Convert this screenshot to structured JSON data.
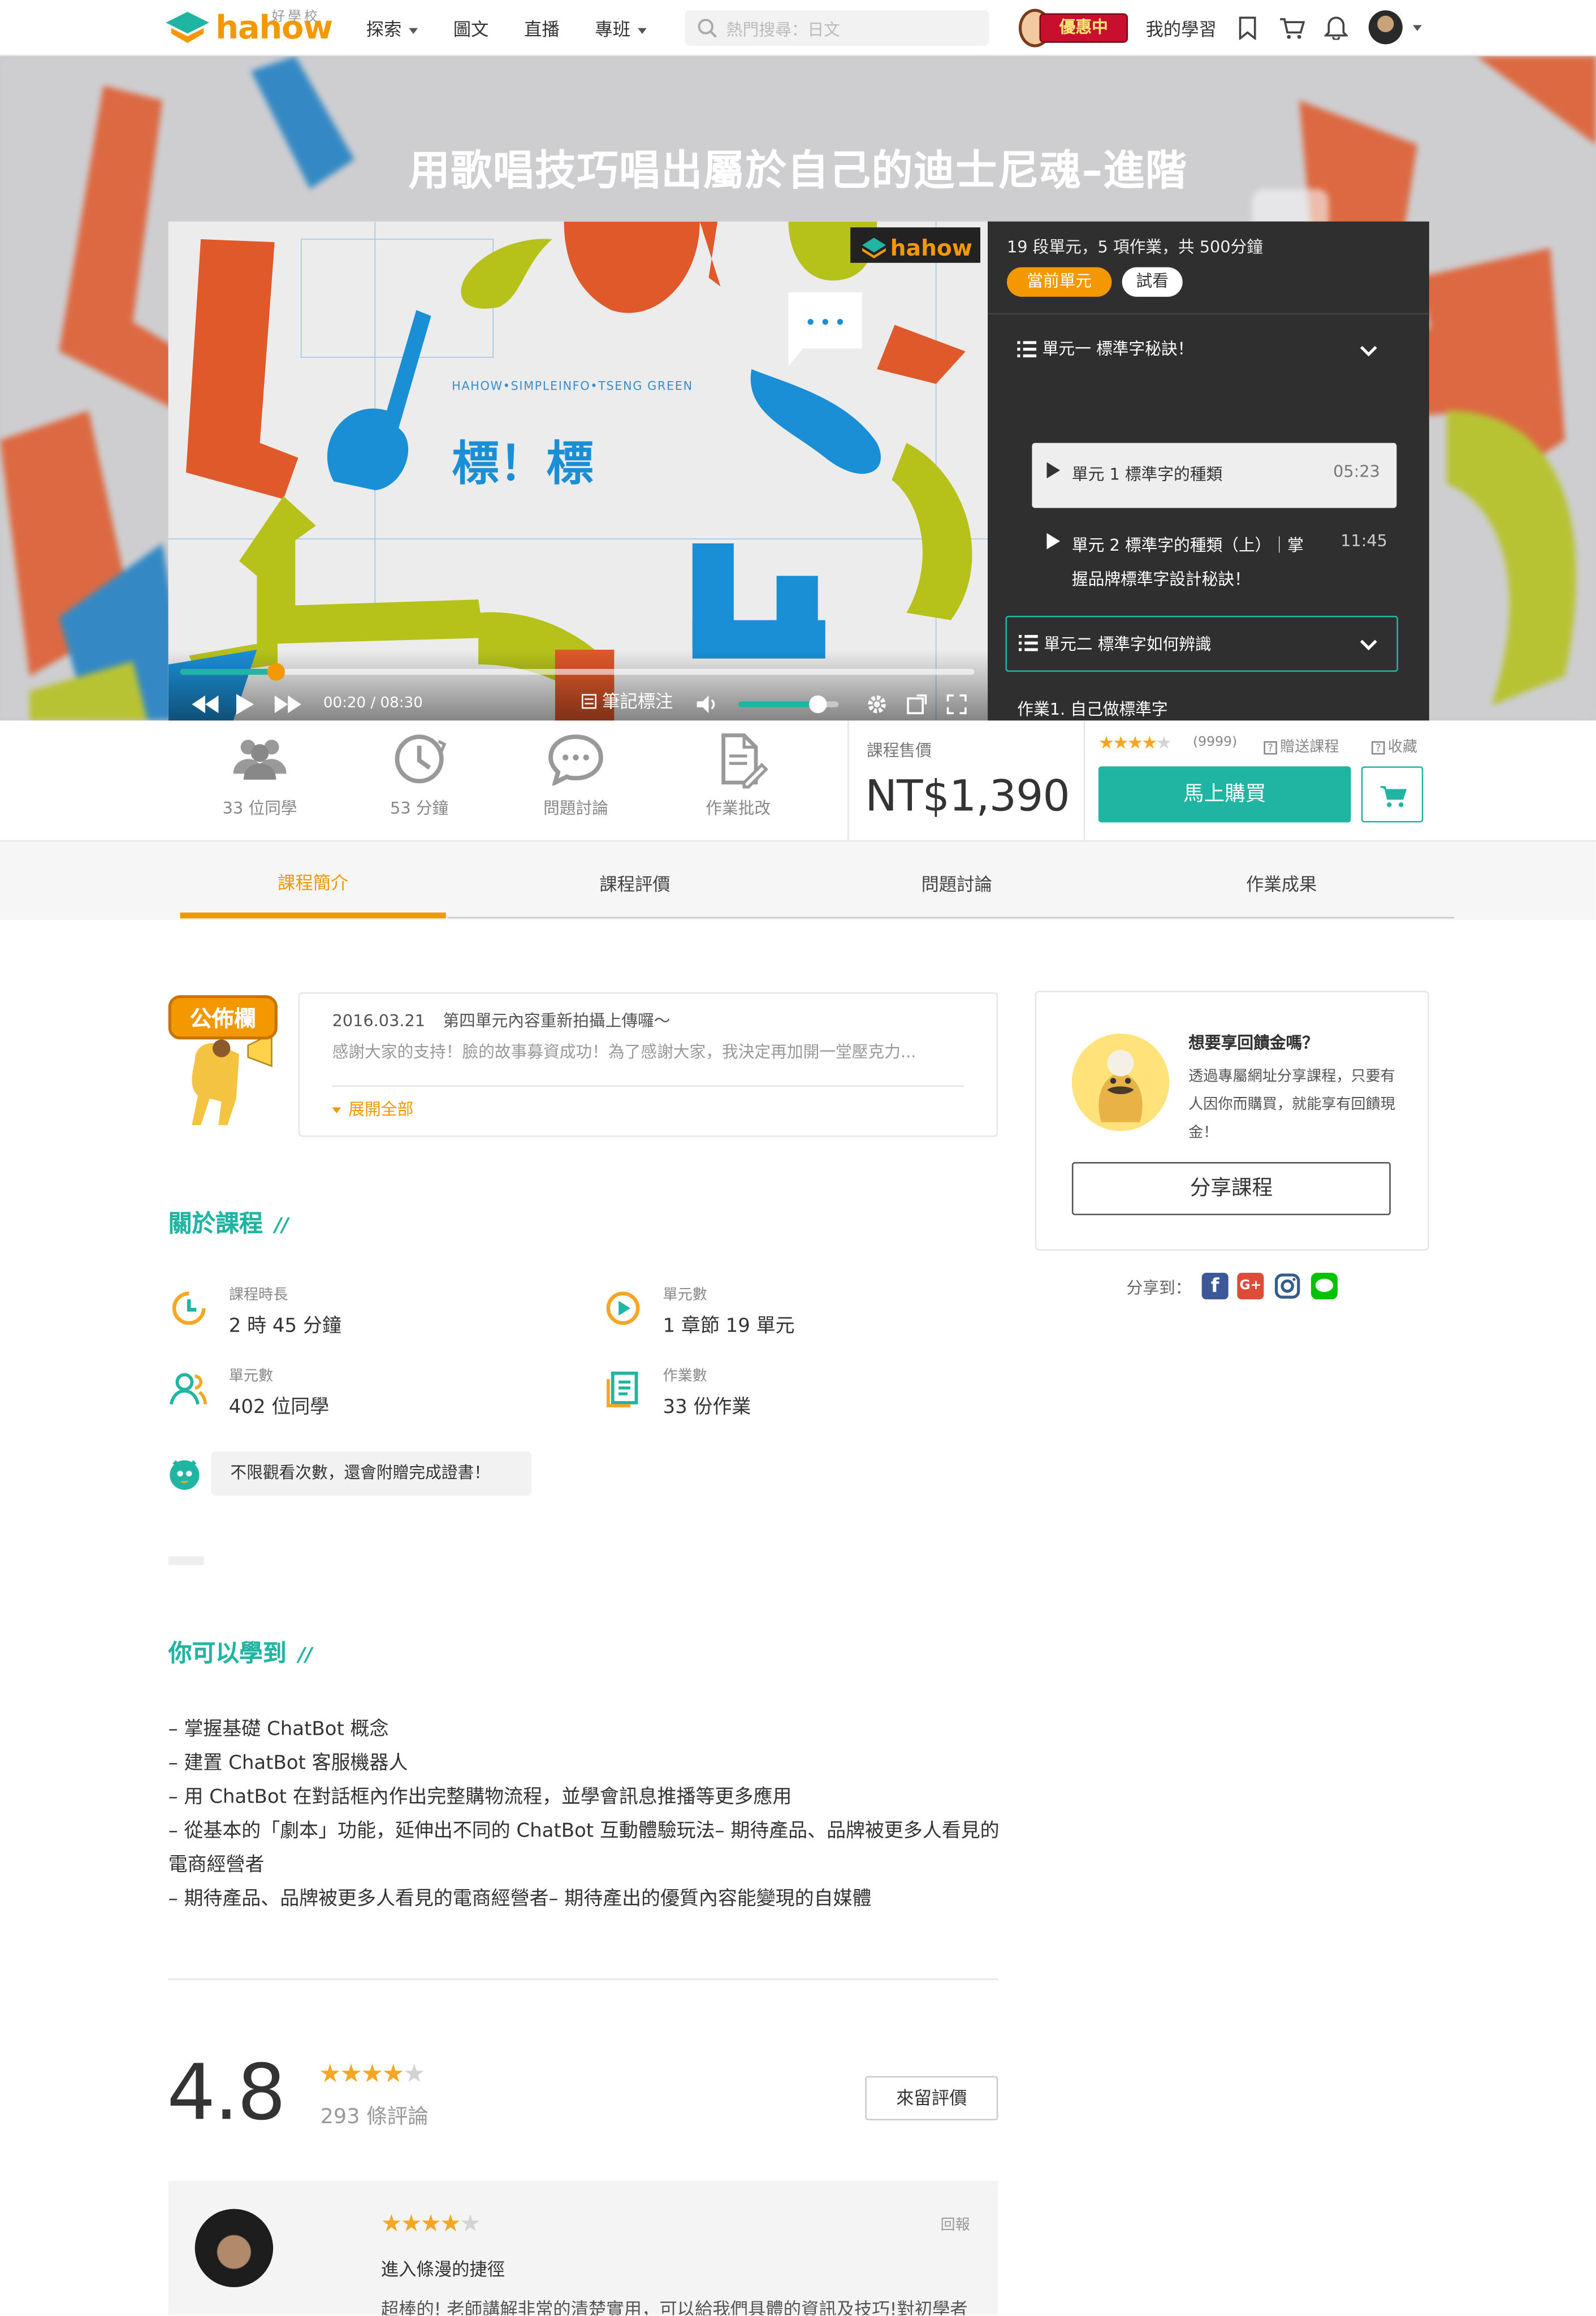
{
  "nav": {
    "logo_text": "hahow",
    "logo_sub": "好學校",
    "explore": "探索",
    "articles": "圖文",
    "live": "直播",
    "topics": "專班",
    "search_placeholder": "熱門搜尋：日文",
    "promo_badge": "優惠中",
    "my_learning": "我的學習"
  },
  "course": {
    "title": "用歌唱技巧唱出屬於自己的迪士尼魂–進階"
  },
  "video": {
    "brand_small": "好學校",
    "brand": "hahow",
    "credit": "HAHOW•SIMPLEINFO•TSENG GREEN",
    "time": "00:20 / 08:30",
    "note_button": "筆記標注",
    "progress": 0.12,
    "volume": 0.8
  },
  "playlist": {
    "summary": "19 段單元，5 項作業，共 500分鐘",
    "current_btn": "當前單元",
    "preview_btn": "試看",
    "chapter1": "單元一 標準字秘訣！",
    "lesson1_title": "單元 1 標準字的種類",
    "lesson1_time": "05:23",
    "lesson2_title": "單元 2 標準字的種類（上）｜掌握品牌標準字設計秘訣！",
    "lesson2_time": "11:45",
    "chapter2": "單元二 標準字如何辨識",
    "homework": "作業1. 自己做標準字"
  },
  "stats": {
    "students": "33 位同學",
    "minutes": "53 分鐘",
    "discussion": "問題討論",
    "homework_review": "作業批改"
  },
  "price": {
    "label": "課程售價",
    "value": "NT$1,390",
    "rating_count": "(9999)",
    "rating": 4,
    "gift": "贈送課程",
    "favorite": "收藏",
    "buy": "馬上購買"
  },
  "tabs": [
    "課程簡介",
    "課程評價",
    "問題討論",
    "作業成果"
  ],
  "notice": {
    "badge": "公佈欄",
    "date": "2016.03.21",
    "headline": "第四單元內容重新拍攝上傳囉～",
    "body": "感謝大家的支持！臉的故事募資成功！為了感謝大家，我決定再加開一堂壓克力...",
    "expand": "展開全部"
  },
  "about": {
    "title": "關於課程",
    "slash": "//",
    "items": [
      {
        "label": "課程時長",
        "value": "2 時 45 分鐘"
      },
      {
        "label": "單元數",
        "value": "1 章節 19 單元"
      },
      {
        "label": "單元數",
        "value": "402 位同學"
      },
      {
        "label": "作業數",
        "value": "33 份作業"
      }
    ],
    "certificate": "不限觀看次數，還會附贈完成證書！"
  },
  "learn": {
    "title": "你可以學到",
    "slash": "//",
    "items": [
      "– 掌握基礎 ChatBot 概念",
      "– 建置 ChatBot 客服機器人",
      "– 用 ChatBot 在對話框內作出完整購物流程，並學會訊息推播等更多應用",
      "– 從基本的「劇本」功能，延伸出不同的 ChatBot 互動體驗玩法– 期待產品、品牌被更多人看見的電商經營者",
      "– 期待產品、品牌被更多人看見的電商經營者– 期待產出的優質內容能變現的自媒體"
    ]
  },
  "share": {
    "title": "想要享回饋金嗎？",
    "desc": "透過專屬網址分享課程，只要有人因你而購買，就能享有回饋現金！",
    "button": "分享課程",
    "share_to": "分享到："
  },
  "reviews": {
    "score": "4.8",
    "rating": 4,
    "count": "293 條評論",
    "leave": "來留評價",
    "first": {
      "rating": 4,
      "report": "回報",
      "title": "進入條漫的捷徑",
      "body": "超棒的! 老師講解非常的清楚實用，可以給我們具體的資訊及技巧!對初學者"
    }
  },
  "colors": {
    "brand_orange": "#f39800",
    "accent_teal": "#1fb5a2",
    "tab_active": "#f39800",
    "dark_panel": "#2f2f2f"
  }
}
